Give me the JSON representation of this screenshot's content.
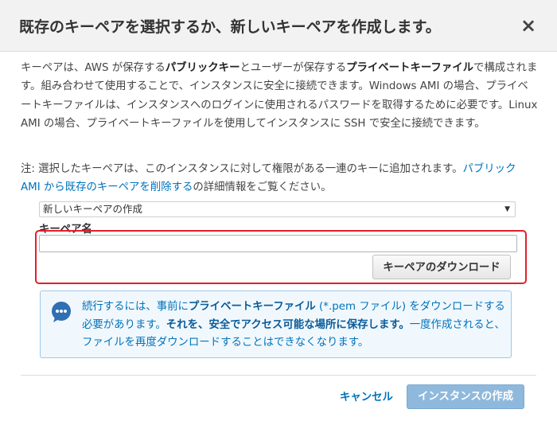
{
  "dialog": {
    "title": "既存のキーペアを選択するか、新しいキーペアを作成します。",
    "close_label": "×"
  },
  "description": {
    "p1": "キーペアは、AWS が保存する",
    "b1": "パブリックキー",
    "p2": "とユーザーが保存する",
    "b2": "プライベートキーファイル",
    "p3": "で構成されます。組み合わせて使用することで、インスタンスに安全に接続できます。Windows AMI の場合、プライベートキーファイルは、インスタンスへのログインに使用されるパスワードを取得するために必要です。Linux AMI の場合、プライベートキーファイルを使用してインスタンスに SSH で安全に接続できます。"
  },
  "note": {
    "text_before": "注: 選択したキーペアは、このインスタンスに対して権限がある一連のキーに追加されます。",
    "link": "パブリック AMI から既存のキーペアを削除する",
    "text_after": "の詳細情報をご覧ください。"
  },
  "keypair_select": {
    "selected": "新しいキーペアの作成"
  },
  "keypair_name": {
    "label": "キーペア名",
    "value": ""
  },
  "download_button": "キーペアのダウンロード",
  "info": {
    "t1": "続行するには、事前に",
    "b1": "プライベートキーファイル",
    "t2": " (*.pem ファイル) をダウンロードする必要があります。",
    "b2": "それを、安全でアクセス可能な場所に保存します。",
    "t3": "一度作成されると、ファイルを再度ダウンロードすることはできなくなります。"
  },
  "footer": {
    "cancel": "キャンセル",
    "create": "インスタンスの作成"
  },
  "colors": {
    "link": "#0073bb",
    "highlight": "#e0212b",
    "primary_disabled": "#8fb9dc",
    "info_bg": "#f1f8fd"
  }
}
